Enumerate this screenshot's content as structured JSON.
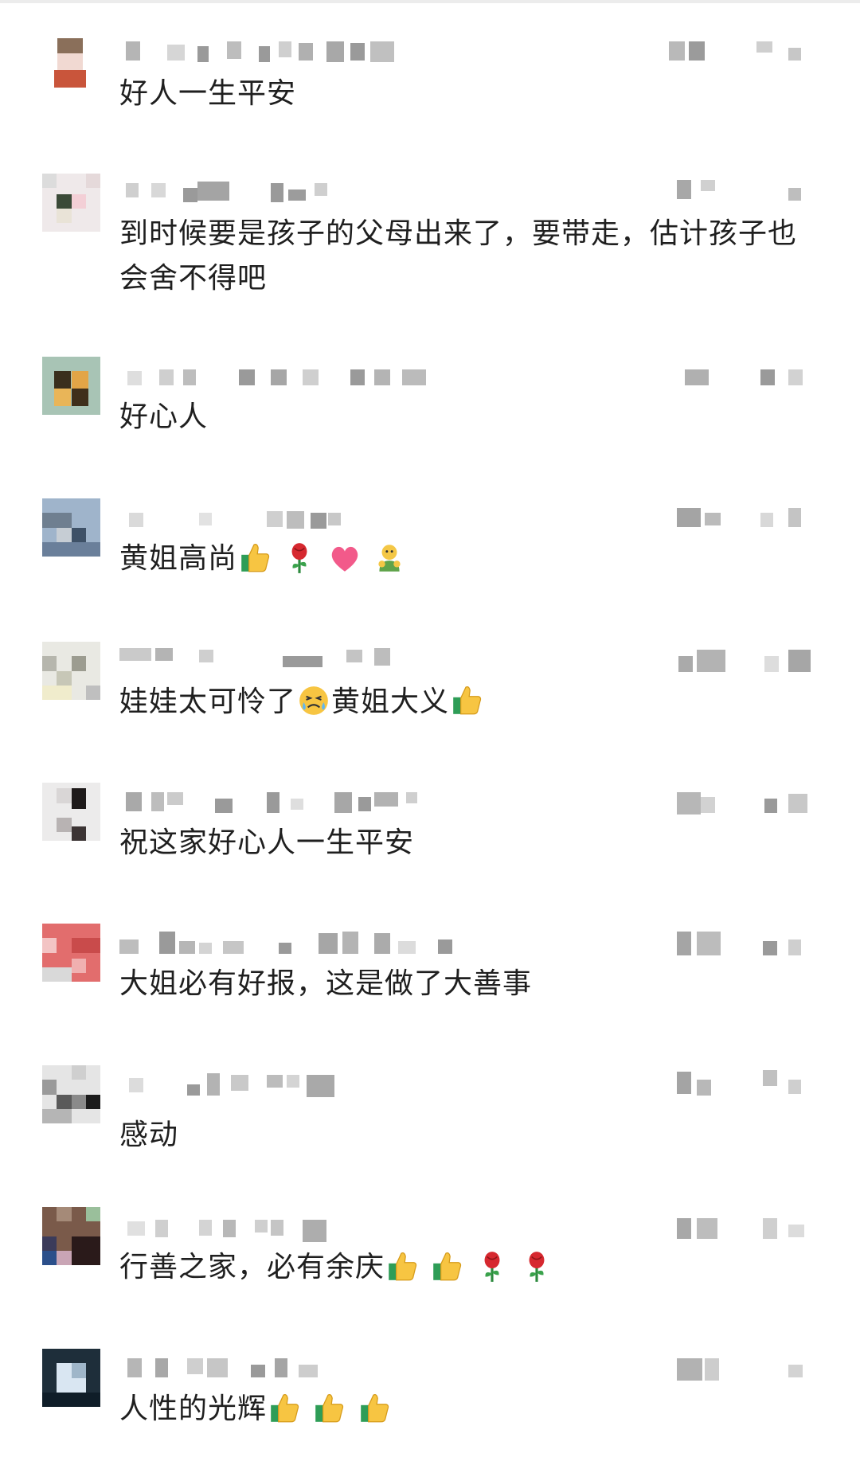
{
  "comments": [
    {
      "text": "好人一生平安",
      "emojis": []
    },
    {
      "text": "到时候要是孩子的父母出来了，要带走，估计孩子也会舍不得吧",
      "emojis": []
    },
    {
      "text": "好心人",
      "emojis": []
    },
    {
      "text": "黄姐高尚",
      "emojis": [
        "thumbs-up",
        "rose",
        "heart",
        "hug"
      ]
    },
    {
      "text": "娃娃太可怜了",
      "emojis": [
        "crying-face"
      ],
      "text2": "黄姐大义",
      "emojis2": [
        "thumbs-up"
      ]
    },
    {
      "text": "祝这家好心人一生平安",
      "emojis": []
    },
    {
      "text": "大姐必有好报，这是做了大善事",
      "emojis": []
    },
    {
      "text": "感动",
      "emojis": []
    },
    {
      "text": "行善之家，必有余庆",
      "emojis": [
        "thumbs-up",
        "thumbs-up",
        "rose",
        "rose"
      ]
    },
    {
      "text": "人性的光辉",
      "emojis": [
        "thumbs-up",
        "thumbs-up",
        "thumbs-up"
      ]
    }
  ],
  "colors": {
    "text": "#1f1f1f",
    "blur_block": "#9a9a9a",
    "background": "#ffffff"
  }
}
